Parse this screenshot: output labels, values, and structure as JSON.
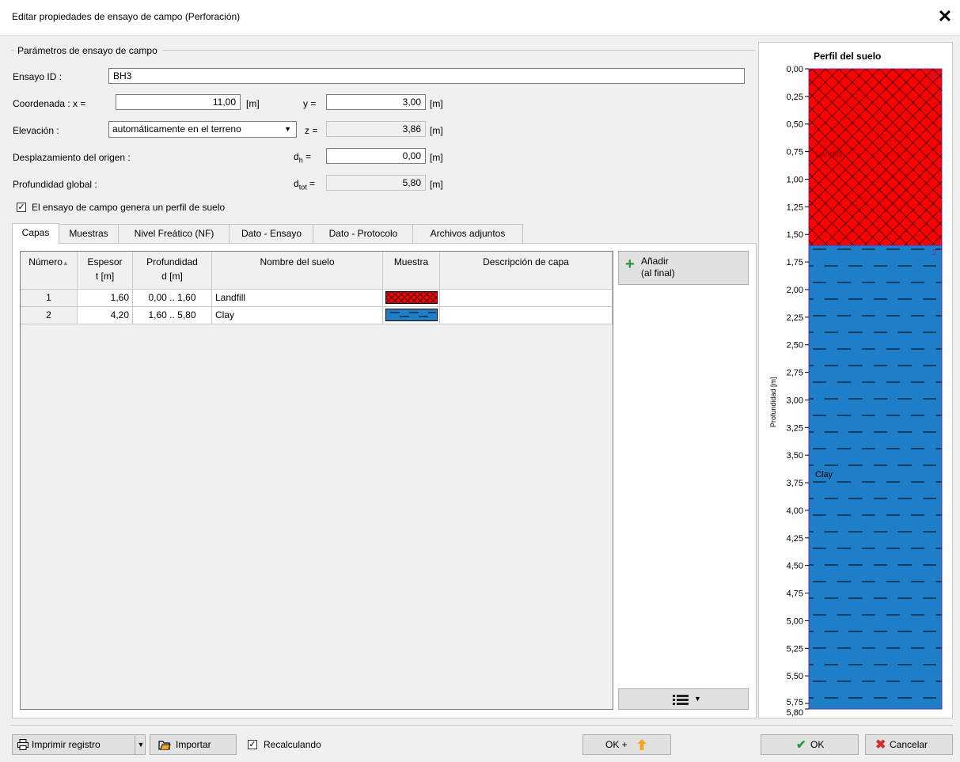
{
  "window": {
    "title": "Editar propiedades de ensayo de campo (Perforación)",
    "close_glyph": "✕"
  },
  "params": {
    "group_title": "Parámetros de ensayo de campo",
    "id_label": "Ensayo ID :",
    "id_value": "BH3",
    "coord_label": "Coordenada : x =",
    "x_value": "11,00",
    "unit_m": "[m]",
    "y_label": "y =",
    "y_value": "3,00",
    "elev_label": "Elevación :",
    "elev_select": "automáticamente en el terreno",
    "z_label": "z =",
    "z_value": "3,86",
    "origin_label": "Desplazamiento del origen :",
    "dh_label_main": "d",
    "dh_label_sub": "h",
    "dh_label_tail": " =",
    "dh_value": "0,00",
    "depth_label": "Profundidad global :",
    "dtot_label_main": "d",
    "dtot_label_sub": "tot",
    "dtot_label_tail": " =",
    "dtot_value": "5,80",
    "generates_profile_label": "El ensayo de campo genera un perfil de suelo",
    "generates_profile_checked": true
  },
  "tabs": [
    "Capas",
    "Muestras",
    "Nivel Freático (NF)",
    "Dato - Ensayo",
    "Dato - Protocolo",
    "Archivos adjuntos"
  ],
  "active_tab": "Capas",
  "layers_table": {
    "headers": [
      {
        "line1": "Número",
        "line2": "",
        "sort": "▲"
      },
      {
        "line1": "Espesor",
        "line2": "t [m]"
      },
      {
        "line1": "Profundidad",
        "line2": "d [m]"
      },
      {
        "line1": "Nombre del suelo",
        "line2": ""
      },
      {
        "line1": "Muestra",
        "line2": ""
      },
      {
        "line1": "Descripción de capa",
        "line2": ""
      }
    ],
    "rows": [
      {
        "num": "1",
        "thickness": "1,60",
        "depth": "0,00 .. 1,60",
        "soil": "Landfill",
        "pattern": "landfill",
        "desc": ""
      },
      {
        "num": "2",
        "thickness": "4,20",
        "depth": "1,60 .. 5,80",
        "soil": "Clay",
        "pattern": "clay",
        "desc": ""
      }
    ]
  },
  "side_buttons": {
    "add_line1": "Añadir",
    "add_line2": "(al final)",
    "add_icon": "+",
    "menu_icon": "list-menu-icon"
  },
  "profile": {
    "title": "Perfil del suelo",
    "axis_label": "Profundidad [m]",
    "ticks": [
      "0,00",
      "0,25",
      "0,50",
      "0,75",
      "1,00",
      "1,25",
      "1,50",
      "1,75",
      "2,00",
      "2,25",
      "2,50",
      "2,75",
      "3,00",
      "3,25",
      "3,50",
      "3,75",
      "4,00",
      "4,25",
      "4,50",
      "4,75",
      "5,00",
      "5,25",
      "5,50",
      "5,75",
      "5,80"
    ],
    "layers": [
      {
        "name": "Landfill",
        "num": "1",
        "from": 0.0,
        "to": 1.6,
        "color": "#ff0000"
      },
      {
        "name": "Clay",
        "num": "2",
        "from": 1.6,
        "to": 5.8,
        "color": "#1e7fc8"
      }
    ]
  },
  "footer": {
    "print_label": "Imprimir registro",
    "import_label": "Importar",
    "recalc_label": "Recalculando",
    "recalc_checked": true,
    "okplus_label": "OK +",
    "ok_label": "OK",
    "cancel_label": "Cancelar"
  },
  "colors": {
    "accent_green": "#1e9a3b",
    "cancel_red": "#d32f2f",
    "arrow_orange": "#f5a623"
  }
}
